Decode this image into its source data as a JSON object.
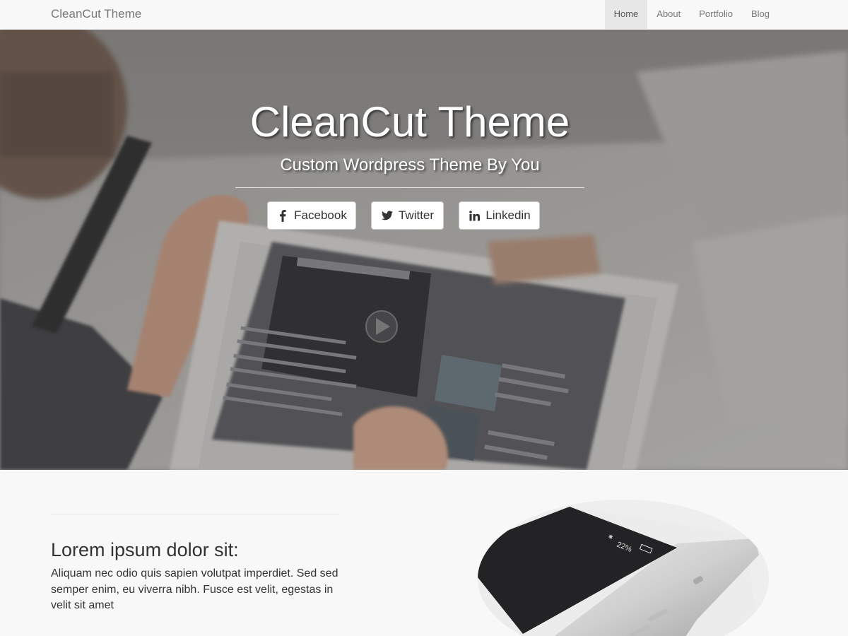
{
  "navbar": {
    "brand": "CleanCut Theme",
    "items": [
      {
        "label": "Home",
        "active": true
      },
      {
        "label": "About",
        "active": false
      },
      {
        "label": "Portfolio",
        "active": false
      },
      {
        "label": "Blog",
        "active": false
      }
    ]
  },
  "hero": {
    "title": "CleanCut Theme",
    "subtitle": "Custom Wordpress Theme By You",
    "buttons": [
      {
        "label": "Facebook",
        "icon": "facebook-icon"
      },
      {
        "label": "Twitter",
        "icon": "twitter-icon"
      },
      {
        "label": "Linkedin",
        "icon": "linkedin-icon"
      }
    ]
  },
  "section": {
    "heading": "Lorem ipsum dolor sit:",
    "body": "Aliquam nec odio quis sapien volutpat imperdiet. Sed sed semper enim, eu viverra nibh. Fusce est velit, egestas in velit sit amet",
    "device_battery": "22%"
  },
  "colors": {
    "navbar_bg": "#f8f8f8",
    "nav_active_bg": "#e7e7e7",
    "hero_text": "#ffffff",
    "body_text": "#333333"
  }
}
